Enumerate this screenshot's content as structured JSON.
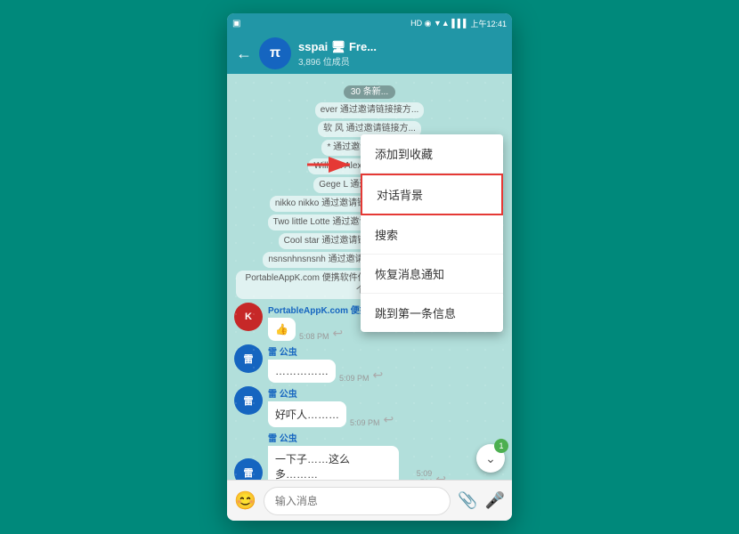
{
  "statusBar": {
    "leftIcon": "▣",
    "time": "上午12:41",
    "signalIcons": "HD ◉ ▼◀▲▶ ▌▌▌"
  },
  "header": {
    "backLabel": "←",
    "avatarLabel": "π",
    "name": "sspai 🖥 Fre...",
    "sub": "3,896 位成员"
  },
  "newMessages": {
    "label": "30 条新..."
  },
  "systemMessages": [
    "ever 通过邀请链接接方...",
    "软 风 通过邀请链接方...",
    "* 通过邀请链接方式...",
    "William Alex 通过邀请链接...",
    "Gege L 通过邀请链接接...",
    "nikko nikko 通过邀请链接接方式加入了这个群组",
    "Two little Lotte 通过邀请链接方式加入了这个群组",
    "Cool star 通过邀请链接方式加入了这个群组",
    "nsnsnhnsnsnh 通过邀请链接接方式加入了这个群组",
    "PortableAppK.com 便携软件倡导者 通过邀请链接方式加入了这个群组"
  ],
  "messages": [
    {
      "id": "msg1",
      "sender": "PortableAppK.com 便携软件倡导者",
      "avatarLabel": "K",
      "avatarColor": "red",
      "text": "👍",
      "time": "5:08 PM",
      "outgoing": false
    },
    {
      "id": "msg2",
      "sender": "雷 公虫",
      "avatarLabel": "雷",
      "avatarColor": "blue",
      "text": "……………",
      "time": "5:09 PM",
      "outgoing": false
    },
    {
      "id": "msg3",
      "sender": "雷 公虫",
      "avatarLabel": "雷",
      "avatarColor": "blue",
      "text": "好吓人……… ",
      "time": "5:09 PM",
      "outgoing": false
    },
    {
      "id": "msg4",
      "sender": "雷 公虫",
      "avatarLabel": "雷",
      "avatarColor": "blue",
      "text": "一下子……这么多………",
      "time": "5:09 PM",
      "outgoing": false
    }
  ],
  "scrollBadge": "1",
  "footer": {
    "placeholder": "输入消息",
    "emojiIcon": "😊",
    "attachIcon": "📎",
    "micIcon": "🎤"
  },
  "dropdownMenu": {
    "items": [
      {
        "id": "add-to-favorites",
        "label": "添加到收藏",
        "highlighted": false
      },
      {
        "id": "chat-background",
        "label": "对话背景",
        "highlighted": true
      },
      {
        "id": "search",
        "label": "搜索",
        "highlighted": false
      },
      {
        "id": "restore-notifications",
        "label": "恢复消息通知",
        "highlighted": false
      },
      {
        "id": "jump-to-first",
        "label": "跳到第一条信息",
        "highlighted": false
      }
    ]
  }
}
